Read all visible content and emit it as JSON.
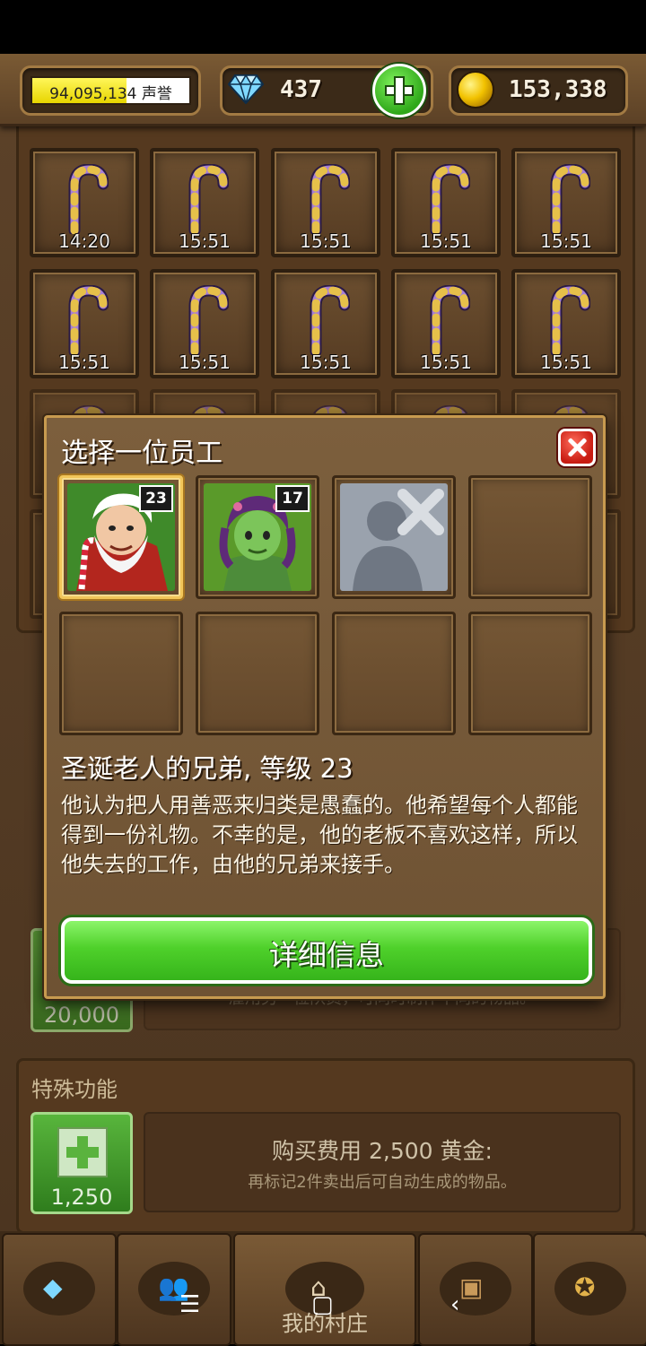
{
  "topbar": {
    "reputation": {
      "value_text": "94,095,134",
      "unit": "声誉",
      "fill_fraction": 0.6
    },
    "gems": "437",
    "gold": "153,338"
  },
  "storage_section": {
    "slots": [
      {
        "time": "14:20"
      },
      {
        "time": "15:51"
      },
      {
        "time": "15:51"
      },
      {
        "time": "15:51"
      },
      {
        "time": "15:51"
      },
      {
        "time": "15:51"
      },
      {
        "time": "15:51"
      },
      {
        "time": "15:51"
      },
      {
        "time": "15:51"
      },
      {
        "time": "15:51"
      }
    ]
  },
  "hire_section": {
    "price": "20,000",
    "desc": "雇用另一位队员，可同时制作不同的物品。"
  },
  "special_section": {
    "title": "特殊功能",
    "button_price": "1,250",
    "line1": "购买费用 2,500 黄金:",
    "line2": "再标记2件卖出后可自动生成的物品。"
  },
  "modal": {
    "title": "选择一位员工",
    "workers": [
      {
        "level": "23",
        "name": "santa-brother",
        "selected": true
      },
      {
        "level": "17",
        "name": "green-girl",
        "selected": false
      },
      {
        "level": "",
        "name": "unavailable",
        "selected": false
      }
    ],
    "worker_name": "圣诞老人的兄弟, 等级 23",
    "worker_desc": "他认为把人用善恶来归类是愚蠢的。他希望每个人都能得到一份礼物。不幸的是，他的老板不喜欢这样，所以他失去的工作，由他的兄弟来接手。",
    "details_button": "详细信息"
  },
  "tabbar": {
    "tabs": [
      {
        "icon": "diamond-icon"
      },
      {
        "icon": "people-icon"
      },
      {
        "icon": "house-icon",
        "label": "我的村庄"
      },
      {
        "icon": "chest-icon"
      },
      {
        "icon": "medal-icon"
      }
    ]
  },
  "system_nav": {
    "menu": "☰",
    "home": "▢",
    "back": "‹"
  },
  "colors": {
    "wood": "#5a4027",
    "gold_border": "#c79a4f",
    "green_button": "#4fd12b",
    "close_red": "#c81c12"
  }
}
